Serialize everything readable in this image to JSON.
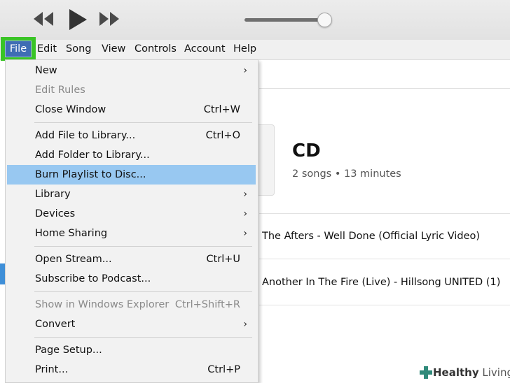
{
  "toolbar": {
    "icons": [
      "previous-icon",
      "play-icon",
      "next-icon"
    ],
    "volume_level": 0.9
  },
  "menubar": {
    "items": [
      "File",
      "Edit",
      "Song",
      "View",
      "Controls",
      "Account",
      "Help"
    ]
  },
  "file_menu": {
    "items": [
      {
        "label": "New",
        "submenu": true
      },
      {
        "label": "Edit Rules",
        "disabled": true
      },
      {
        "label": "Close Window",
        "shortcut": "Ctrl+W"
      },
      {
        "label": "Add File to Library...",
        "shortcut": "Ctrl+O"
      },
      {
        "label": "Add Folder to Library..."
      },
      {
        "label": "Burn Playlist to Disc...",
        "highlighted": true
      },
      {
        "label": "Library",
        "submenu": true
      },
      {
        "label": "Devices",
        "submenu": true
      },
      {
        "label": "Home Sharing",
        "submenu": true
      },
      {
        "label": "Open Stream...",
        "shortcut": "Ctrl+U"
      },
      {
        "label": "Subscribe to Podcast..."
      },
      {
        "label": "Show in Windows Explorer",
        "shortcut": "Ctrl+Shift+R",
        "disabled": true
      },
      {
        "label": "Convert",
        "submenu": true
      },
      {
        "label": "Page Setup..."
      },
      {
        "label": "Print...",
        "shortcut": "Ctrl+P"
      }
    ]
  },
  "album": {
    "title": "CD",
    "subtitle": "2 songs • 13 minutes"
  },
  "songs": [
    "The Afters - Well Done (Official Lyric Video)",
    "Another In The Fire (Live) - Hillsong UNITED (1)"
  ],
  "watermark": {
    "word1": "Healthy",
    "word2": " Living"
  },
  "colors": {
    "highlight_box": "#39c425",
    "menu_highlight": "#98c8f1",
    "active_menu": "#3f6db4"
  }
}
